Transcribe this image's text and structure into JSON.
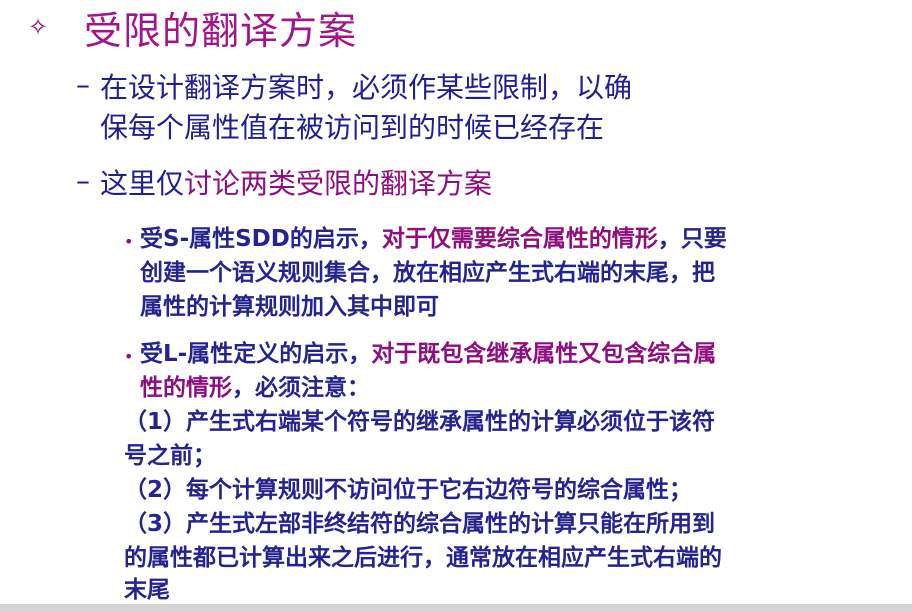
{
  "title": {
    "icon": "diamond-outline-icon",
    "text": "受限的翻译方案"
  },
  "points": [
    {
      "marker": "–",
      "lines": [
        "在设计翻译方案时，必须作某些限制，以确",
        "保每个属性值在被访问到的时候已经存在"
      ]
    },
    {
      "marker": "–",
      "prefix": "这里仅",
      "highlight": "讨论两类受限的翻译方案"
    }
  ],
  "subpoints": [
    {
      "marker": "•",
      "lead": "受S-属性SDD的启示，",
      "highlight": "对于仅需要综合属性的情形",
      "tail": "，只要",
      "lines": [
        "创建一个语义规则集合，放在相应产生式右端的末尾，把",
        "属性的计算规则加入其中即可"
      ]
    },
    {
      "marker": "•",
      "lead": "受L-属性定义的启示，",
      "highlight_line1": "对于既包含继承属性又包含综合属",
      "highlight_line2": "性的情形",
      "tail": "，必须注意：",
      "lines": [
        "（1）产生式右端某个符号的继承属性的计算必须位于该符",
        "号之前；",
        "（2）每个计算规则不访问位于它右边符号的综合属性；",
        "（3）产生式左部非终结符的综合属性的计算只能在所用到",
        "的属性都已计算出来之后进行，通常放在相应产生式右端的",
        "末尾"
      ]
    }
  ],
  "colors": {
    "navy": "#1f1f8f",
    "purple": "#8e0e7e",
    "title": "#a0168a"
  }
}
